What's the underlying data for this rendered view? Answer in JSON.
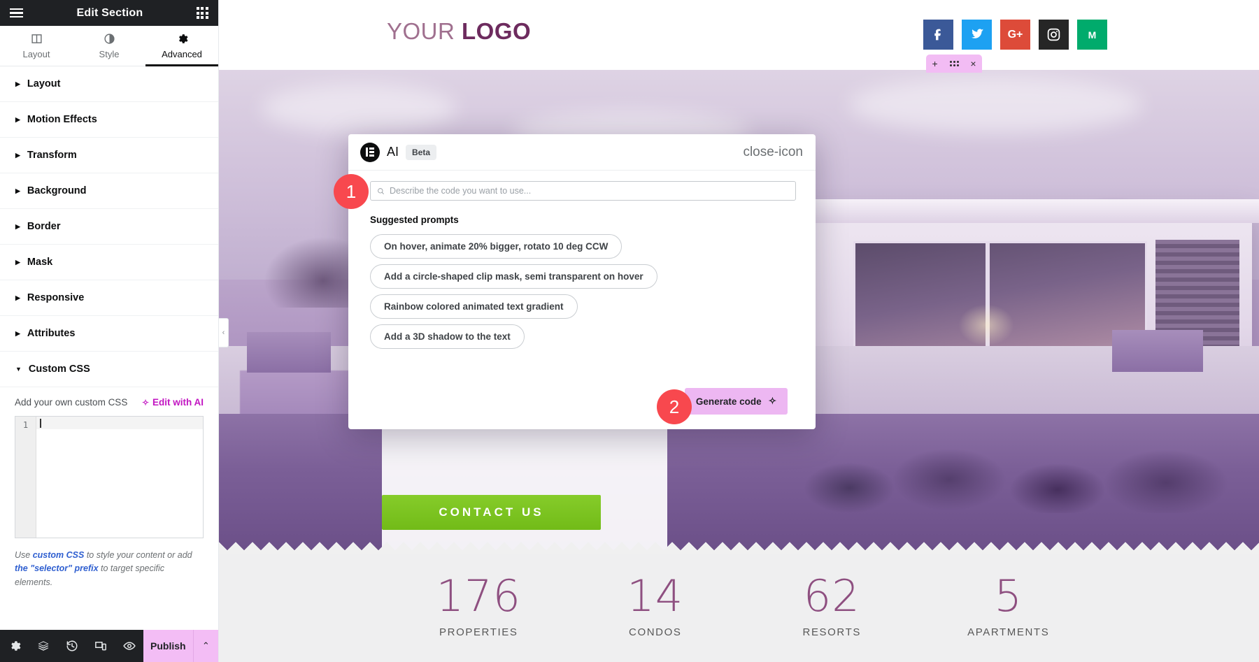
{
  "panel": {
    "title": "Edit Section",
    "menu_icon": "hamburger-icon",
    "apps_icon": "grid-apps-icon",
    "tabs": [
      {
        "label": "Layout",
        "icon": "columns-icon",
        "active": false
      },
      {
        "label": "Style",
        "icon": "contrast-circle-icon",
        "active": false
      },
      {
        "label": "Advanced",
        "icon": "gear-icon",
        "active": true
      }
    ],
    "sections": [
      {
        "label": "Layout",
        "expanded": false
      },
      {
        "label": "Motion Effects",
        "expanded": false
      },
      {
        "label": "Transform",
        "expanded": false
      },
      {
        "label": "Background",
        "expanded": false
      },
      {
        "label": "Border",
        "expanded": false
      },
      {
        "label": "Mask",
        "expanded": false
      },
      {
        "label": "Responsive",
        "expanded": false
      },
      {
        "label": "Attributes",
        "expanded": false
      },
      {
        "label": "Custom CSS",
        "expanded": true
      }
    ],
    "custom_css": {
      "field_label": "Add your own custom CSS",
      "edit_with_ai": "Edit with AI",
      "edit_with_ai_color": "#c216c2",
      "line_number": "1",
      "code_value": "",
      "hint_part1": "Use ",
      "hint_link1": "custom CSS",
      "hint_part2": " to style your content or add ",
      "hint_link2": "the \"selector\" prefix",
      "hint_part3": " to target specific elements."
    },
    "collapse_chevron": "‹",
    "footer": {
      "icons": [
        "settings-gear-icon",
        "layers-navigator-icon",
        "history-revisions-icon",
        "responsive-mode-icon",
        "preview-eye-icon"
      ],
      "publish_label": "Publish",
      "publish_caret": "⌃",
      "publish_color": "#f3bdf5"
    }
  },
  "modal": {
    "brand_icon": "elementor-logo-icon",
    "title": "AI",
    "badge_label": "Beta",
    "close_icon": "close-icon",
    "search": {
      "icon": "search-icon",
      "placeholder": "Describe the code you want to use...",
      "value": ""
    },
    "suggested_title": "Suggested prompts",
    "prompts": [
      "On hover, animate 20% bigger, rotato 10 deg CCW",
      "Add a circle-shaped clip mask, semi transparent on hover",
      "Rainbow colored animated text gradient",
      "Add a 3D shadow to the text"
    ],
    "generate_label": "Generate code",
    "generate_icon": "sparkle-icon",
    "generate_color": "#edb7f2"
  },
  "annotations": [
    {
      "number": "1",
      "target": "ai-prompt-input"
    },
    {
      "number": "2",
      "target": "generate-code-button"
    }
  ],
  "site": {
    "logo_light": "YOUR",
    "logo_bold": "LOGO",
    "socials": [
      {
        "name": "facebook",
        "glyph": "f",
        "color": "#3b5998"
      },
      {
        "name": "twitter",
        "glyph": "t",
        "color": "#1da1f2"
      },
      {
        "name": "google-plus",
        "glyph": "G+",
        "color": "#dd4b39"
      },
      {
        "name": "instagram",
        "glyph": "ig",
        "color": "#262626"
      },
      {
        "name": "medium",
        "glyph": "M",
        "color": "#00ab6c"
      }
    ],
    "section_handle": {
      "add": "+",
      "drag": "drag-dots-icon",
      "close": "×",
      "color": "#f2bcf4"
    },
    "contact_button": "CONTACT US",
    "contact_button_color": "#7dc723",
    "stats": [
      {
        "value": "176",
        "label": "PROPERTIES"
      },
      {
        "value": "14",
        "label": "CONDOS"
      },
      {
        "value": "62",
        "label": "RESORTS"
      },
      {
        "value": "5",
        "label": "APARTMENTS"
      }
    ]
  }
}
